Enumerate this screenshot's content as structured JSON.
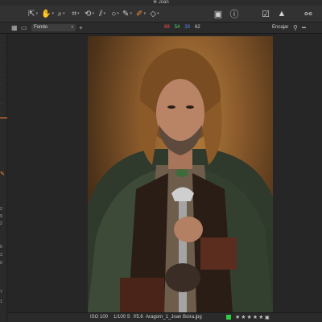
{
  "window": {
    "title": "Joan"
  },
  "toolbar": {
    "tools": [
      {
        "name": "select-tool-icon",
        "glyph": "⇱"
      },
      {
        "name": "pan-tool-icon",
        "glyph": "✋"
      },
      {
        "name": "zoom-tool-icon",
        "glyph": "⌕"
      },
      {
        "name": "crop-tool-icon",
        "glyph": "⌗"
      },
      {
        "name": "rotate-tool-icon",
        "glyph": "⟲"
      },
      {
        "name": "keystone-tool-icon",
        "glyph": "⫽"
      },
      {
        "name": "spot-removal-tool-icon",
        "glyph": "○"
      },
      {
        "name": "color-picker-tool-icon",
        "glyph": "✎"
      },
      {
        "name": "brush-tool-icon",
        "glyph": "✐"
      },
      {
        "name": "eraser-tool-icon",
        "glyph": "◇"
      }
    ],
    "right_tools": [
      {
        "name": "viewer-toggle-icon",
        "glyph": "▣"
      },
      {
        "name": "info-icon",
        "glyph": "ⓘ"
      },
      {
        "name": "compare-icon",
        "glyph": "☑"
      },
      {
        "name": "exposure-warning-icon",
        "glyph": "▲"
      },
      {
        "name": "proof-glasses-icon",
        "glyph": "⚯"
      }
    ]
  },
  "subbar": {
    "view": "Fondo",
    "rgb": {
      "r": "89",
      "g": "54",
      "b": "30",
      "l": "62"
    },
    "fit": "Encajar",
    "colors": {
      "r": "#ff4d4d",
      "g": "#4cd964",
      "b": "#5a8cff",
      "l": "#d0d0d0"
    }
  },
  "leftpanel": {
    "numbers": [
      "2",
      "9",
      "2",
      "5",
      "3",
      "0",
      "7",
      "1"
    ]
  },
  "status": {
    "iso": "ISO 100",
    "shutter": "1/100 S",
    "aperture": "f/5.6",
    "filename": "Aragorn_1_Joan Boira.jpg",
    "rating": "★★★★★",
    "color_tag": "#2ecc40"
  }
}
